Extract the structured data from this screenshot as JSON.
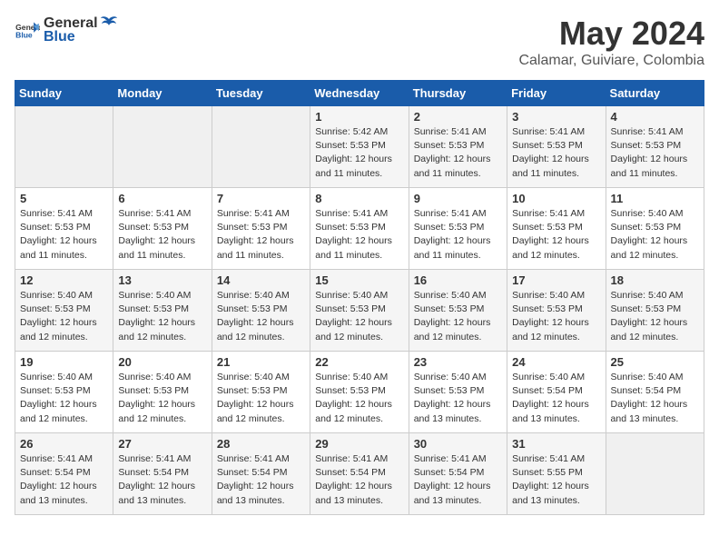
{
  "header": {
    "logo_general": "General",
    "logo_blue": "Blue",
    "month": "May 2024",
    "location": "Calamar, Guiviare, Colombia"
  },
  "weekdays": [
    "Sunday",
    "Monday",
    "Tuesday",
    "Wednesday",
    "Thursday",
    "Friday",
    "Saturday"
  ],
  "weeks": [
    [
      {
        "day": "",
        "empty": true
      },
      {
        "day": "",
        "empty": true
      },
      {
        "day": "",
        "empty": true
      },
      {
        "day": "1",
        "sunrise": "5:42 AM",
        "sunset": "5:53 PM",
        "daylight": "12 hours and 11 minutes."
      },
      {
        "day": "2",
        "sunrise": "5:41 AM",
        "sunset": "5:53 PM",
        "daylight": "12 hours and 11 minutes."
      },
      {
        "day": "3",
        "sunrise": "5:41 AM",
        "sunset": "5:53 PM",
        "daylight": "12 hours and 11 minutes."
      },
      {
        "day": "4",
        "sunrise": "5:41 AM",
        "sunset": "5:53 PM",
        "daylight": "12 hours and 11 minutes."
      }
    ],
    [
      {
        "day": "5",
        "sunrise": "5:41 AM",
        "sunset": "5:53 PM",
        "daylight": "12 hours and 11 minutes."
      },
      {
        "day": "6",
        "sunrise": "5:41 AM",
        "sunset": "5:53 PM",
        "daylight": "12 hours and 11 minutes."
      },
      {
        "day": "7",
        "sunrise": "5:41 AM",
        "sunset": "5:53 PM",
        "daylight": "12 hours and 11 minutes."
      },
      {
        "day": "8",
        "sunrise": "5:41 AM",
        "sunset": "5:53 PM",
        "daylight": "12 hours and 11 minutes."
      },
      {
        "day": "9",
        "sunrise": "5:41 AM",
        "sunset": "5:53 PM",
        "daylight": "12 hours and 11 minutes."
      },
      {
        "day": "10",
        "sunrise": "5:41 AM",
        "sunset": "5:53 PM",
        "daylight": "12 hours and 12 minutes."
      },
      {
        "day": "11",
        "sunrise": "5:40 AM",
        "sunset": "5:53 PM",
        "daylight": "12 hours and 12 minutes."
      }
    ],
    [
      {
        "day": "12",
        "sunrise": "5:40 AM",
        "sunset": "5:53 PM",
        "daylight": "12 hours and 12 minutes."
      },
      {
        "day": "13",
        "sunrise": "5:40 AM",
        "sunset": "5:53 PM",
        "daylight": "12 hours and 12 minutes."
      },
      {
        "day": "14",
        "sunrise": "5:40 AM",
        "sunset": "5:53 PM",
        "daylight": "12 hours and 12 minutes."
      },
      {
        "day": "15",
        "sunrise": "5:40 AM",
        "sunset": "5:53 PM",
        "daylight": "12 hours and 12 minutes."
      },
      {
        "day": "16",
        "sunrise": "5:40 AM",
        "sunset": "5:53 PM",
        "daylight": "12 hours and 12 minutes."
      },
      {
        "day": "17",
        "sunrise": "5:40 AM",
        "sunset": "5:53 PM",
        "daylight": "12 hours and 12 minutes."
      },
      {
        "day": "18",
        "sunrise": "5:40 AM",
        "sunset": "5:53 PM",
        "daylight": "12 hours and 12 minutes."
      }
    ],
    [
      {
        "day": "19",
        "sunrise": "5:40 AM",
        "sunset": "5:53 PM",
        "daylight": "12 hours and 12 minutes."
      },
      {
        "day": "20",
        "sunrise": "5:40 AM",
        "sunset": "5:53 PM",
        "daylight": "12 hours and 12 minutes."
      },
      {
        "day": "21",
        "sunrise": "5:40 AM",
        "sunset": "5:53 PM",
        "daylight": "12 hours and 12 minutes."
      },
      {
        "day": "22",
        "sunrise": "5:40 AM",
        "sunset": "5:53 PM",
        "daylight": "12 hours and 12 minutes."
      },
      {
        "day": "23",
        "sunrise": "5:40 AM",
        "sunset": "5:53 PM",
        "daylight": "12 hours and 13 minutes."
      },
      {
        "day": "24",
        "sunrise": "5:40 AM",
        "sunset": "5:54 PM",
        "daylight": "12 hours and 13 minutes."
      },
      {
        "day": "25",
        "sunrise": "5:40 AM",
        "sunset": "5:54 PM",
        "daylight": "12 hours and 13 minutes."
      }
    ],
    [
      {
        "day": "26",
        "sunrise": "5:41 AM",
        "sunset": "5:54 PM",
        "daylight": "12 hours and 13 minutes."
      },
      {
        "day": "27",
        "sunrise": "5:41 AM",
        "sunset": "5:54 PM",
        "daylight": "12 hours and 13 minutes."
      },
      {
        "day": "28",
        "sunrise": "5:41 AM",
        "sunset": "5:54 PM",
        "daylight": "12 hours and 13 minutes."
      },
      {
        "day": "29",
        "sunrise": "5:41 AM",
        "sunset": "5:54 PM",
        "daylight": "12 hours and 13 minutes."
      },
      {
        "day": "30",
        "sunrise": "5:41 AM",
        "sunset": "5:54 PM",
        "daylight": "12 hours and 13 minutes."
      },
      {
        "day": "31",
        "sunrise": "5:41 AM",
        "sunset": "5:55 PM",
        "daylight": "12 hours and 13 minutes."
      },
      {
        "day": "",
        "empty": true
      }
    ]
  ]
}
